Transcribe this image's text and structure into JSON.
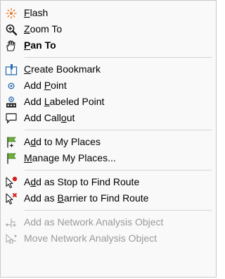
{
  "menu": {
    "groups": [
      [
        {
          "pre": "",
          "key": "F",
          "post": "lash",
          "icon": "flash-icon",
          "bold": false,
          "disabled": false
        },
        {
          "pre": "",
          "key": "Z",
          "post": "oom To",
          "icon": "zoom-to-icon",
          "bold": false,
          "disabled": false
        },
        {
          "pre": "",
          "key": "P",
          "post": "an To",
          "icon": "pan-hand-icon",
          "bold": true,
          "disabled": false
        }
      ],
      [
        {
          "pre": "",
          "key": "C",
          "post": "reate Bookmark",
          "icon": "bookmark-icon",
          "bold": false,
          "disabled": false
        },
        {
          "pre": "Add ",
          "key": "P",
          "post": "oint",
          "icon": "point-icon",
          "bold": false,
          "disabled": false
        },
        {
          "pre": "Add ",
          "key": "L",
          "post": "abeled Point",
          "icon": "labeled-point-icon",
          "bold": false,
          "disabled": false
        },
        {
          "pre": "Add Call",
          "key": "o",
          "post": "ut",
          "icon": "callout-icon",
          "bold": false,
          "disabled": false
        }
      ],
      [
        {
          "pre": "A",
          "key": "d",
          "post": "d to My Places",
          "icon": "add-place-flag-icon",
          "bold": false,
          "disabled": false
        },
        {
          "pre": "",
          "key": "M",
          "post": "anage My Places...",
          "icon": "manage-places-flag-icon",
          "bold": false,
          "disabled": false
        }
      ],
      [
        {
          "pre": "A",
          "key": "d",
          "post": "d as Stop to Find Route",
          "icon": "stop-cursor-icon",
          "bold": false,
          "disabled": false
        },
        {
          "pre": "Add as ",
          "key": "B",
          "post": "arrier to Find Route",
          "icon": "barrier-cursor-icon",
          "bold": false,
          "disabled": false
        }
      ],
      [
        {
          "pre": "Add as Network Analysis Object",
          "key": "",
          "post": "",
          "icon": "network-object-icon",
          "bold": false,
          "disabled": true
        },
        {
          "pre": "Move Network Analysis Object",
          "key": "",
          "post": "",
          "icon": "move-network-object-icon",
          "bold": false,
          "disabled": true
        }
      ]
    ],
    "colors": {
      "background": "#f9f9f9",
      "separator": "#d4d4d4",
      "disabled_text": "#9a9a9a",
      "flag_green": "#6fae3a",
      "stop_red": "#d12020",
      "point_blue": "#2b6cb0"
    }
  }
}
